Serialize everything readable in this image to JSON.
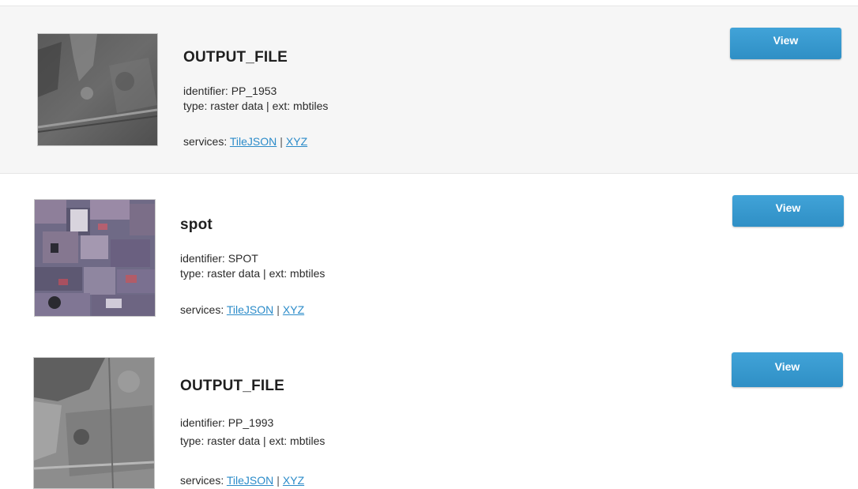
{
  "results": [
    {
      "title": "OUTPUT_FILE",
      "identifier_line": "identifier: PP_1953",
      "type_line": "type: raster data | ext: mbtiles",
      "services_label": "services:",
      "service_links": [
        "TileJSON",
        "XYZ"
      ],
      "view_label": "View",
      "thumbnail": "grayscale-aerial-1953"
    },
    {
      "title": "spot",
      "identifier_line": "identifier: SPOT",
      "type_line": "type: raster data | ext: mbtiles",
      "services_label": "services:",
      "service_links": [
        "TileJSON",
        "XYZ"
      ],
      "view_label": "View",
      "thumbnail": "color-satellite-spot"
    },
    {
      "title": "OUTPUT_FILE",
      "identifier_line": "identifier: PP_1993",
      "type_line": "type: raster data | ext: mbtiles",
      "services_label": "services:",
      "service_links": [
        "TileJSON",
        "XYZ"
      ],
      "view_label": "View",
      "thumbnail": "grayscale-aerial-1993"
    }
  ],
  "colors": {
    "accent": "#2f8fc5",
    "link": "#2b8bc9",
    "highlight_bg": "#f6f6f6"
  }
}
